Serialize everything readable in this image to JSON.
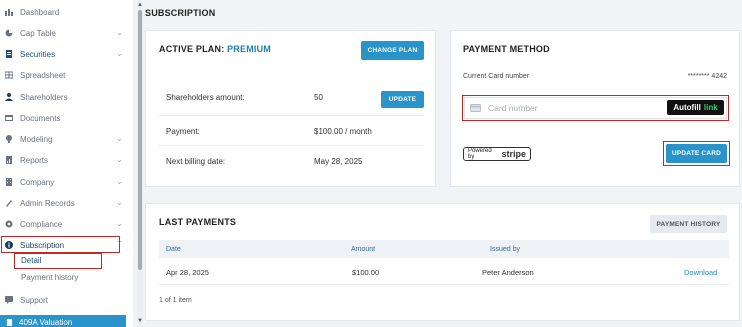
{
  "sidebar": {
    "items": [
      {
        "label": "Dashboard",
        "icon": "bar-chart-icon",
        "chevron": false
      },
      {
        "label": "Cap Table",
        "icon": "pie-chart-icon",
        "chevron": true
      },
      {
        "label": "Securities",
        "icon": "document-icon",
        "chevron": true
      },
      {
        "label": "Spreadsheet",
        "icon": "table-icon",
        "chevron": false
      },
      {
        "label": "Shareholders",
        "icon": "person-icon",
        "chevron": false
      },
      {
        "label": "Documents",
        "icon": "folder-icon",
        "chevron": false
      },
      {
        "label": "Modeling",
        "icon": "lightbulb-icon",
        "chevron": true
      },
      {
        "label": "Reports",
        "icon": "report-icon",
        "chevron": true
      },
      {
        "label": "Company",
        "icon": "building-icon",
        "chevron": true
      },
      {
        "label": "Admin Records",
        "icon": "records-icon",
        "chevron": true
      },
      {
        "label": "Compliance",
        "icon": "gear-icon",
        "chevron": true
      },
      {
        "label": "Subscription",
        "icon": "info-icon",
        "chevron": true
      },
      {
        "label": "Support",
        "icon": "chat-icon",
        "chevron": false
      }
    ],
    "sub_items": [
      {
        "label": "Detail"
      },
      {
        "label": "Payment history"
      }
    ],
    "bottom_item": "409A Valuation"
  },
  "main": {
    "title": "SUBSCRIPTION",
    "plan": {
      "title_prefix": "ACTIVE PLAN:",
      "plan_name": "PREMIUM",
      "change_button": "CHANGE PLAN",
      "rows": [
        {
          "label": "Shareholders amount:",
          "value": "50"
        },
        {
          "label": "Payment:",
          "value": "$100.00 / month"
        },
        {
          "label": "Next billing date:",
          "value": "May 28, 2025"
        }
      ],
      "update_button": "UPDATE"
    },
    "payment_method": {
      "title": "PAYMENT METHOD",
      "current_label": "Current Card number",
      "current_value": "******** 4242",
      "card_placeholder": "Card number",
      "autofill_label": "Autofill",
      "autofill_link": "link",
      "powered_by": "Powered by",
      "stripe": "stripe",
      "update_card_button": "UPDATE CARD"
    },
    "last_payments": {
      "title": "LAST PAYMENTS",
      "history_button": "PAYMENT HISTORY",
      "columns": [
        "Date",
        "Amount",
        "Issued by"
      ],
      "rows": [
        {
          "date": "Apr 28, 2025",
          "amount": "$100.00",
          "issued_by": "Peter Anderson",
          "action": "Download"
        }
      ],
      "pagination": "1 of 1 item"
    }
  },
  "colors": {
    "accent": "#2a93c9",
    "highlight": "#c62828"
  }
}
